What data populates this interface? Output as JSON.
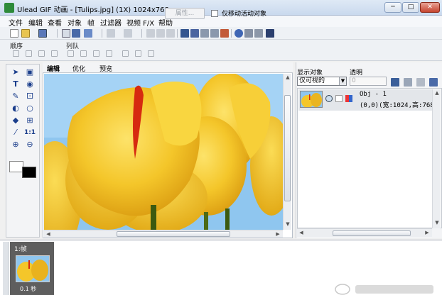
{
  "window": {
    "title": "Ulead GIF 动画 - [Tulips.jpg] (1X) 1024x768",
    "min_label": "─",
    "max_label": "□",
    "close_label": "✕"
  },
  "menu": [
    "文件",
    "编辑",
    "查看",
    "对象",
    "帧",
    "过滤器",
    "视频 F/X",
    "帮助"
  ],
  "toolbar2": {
    "order_label": "顺序",
    "queue_label": "列队",
    "attr_button": "属性...",
    "only_move_label": "仅移动活动对象"
  },
  "tools": {
    "text_tool": "T",
    "frame_count": "1:1"
  },
  "canvas": {
    "tabs": [
      "编辑",
      "优化",
      "预览"
    ],
    "active_tab": "编辑"
  },
  "object_manager": {
    "display_label": "显示对象",
    "opacity_label": "透明",
    "display_value": "仅可视的",
    "opacity_value": "0",
    "object_name": "Obj - 1",
    "object_info": "(0,0)(宽:1024,高:768)"
  },
  "frames": {
    "frame_label": "1:帧",
    "frame_delay": "0.1 秒"
  },
  "colors": {
    "sky": "#8fc6ef",
    "tulip_yellow": "#f4c62a",
    "tulip_orange": "#e9a612",
    "stripe_red": "#d62a10",
    "stem_green": "#3c5a10"
  }
}
